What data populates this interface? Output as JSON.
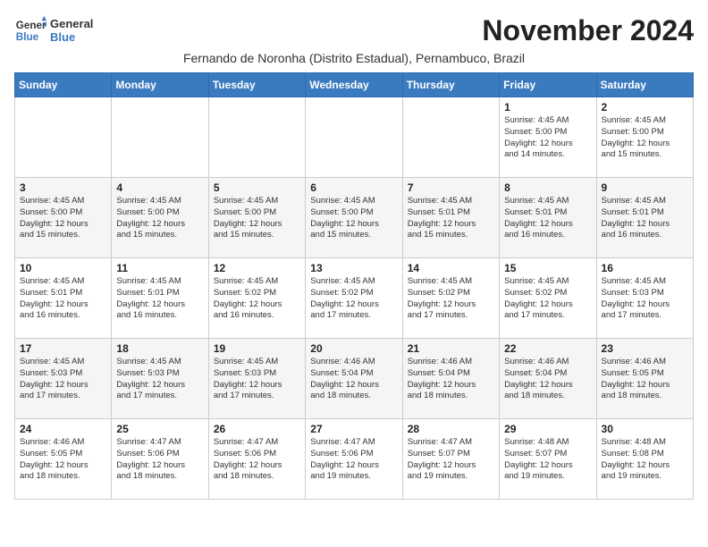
{
  "logo": {
    "line1": "General",
    "line2": "Blue"
  },
  "title": "November 2024",
  "subtitle": "Fernando de Noronha (Distrito Estadual), Pernambuco, Brazil",
  "weekdays": [
    "Sunday",
    "Monday",
    "Tuesday",
    "Wednesday",
    "Thursday",
    "Friday",
    "Saturday"
  ],
  "weeks": [
    [
      {
        "day": "",
        "info": ""
      },
      {
        "day": "",
        "info": ""
      },
      {
        "day": "",
        "info": ""
      },
      {
        "day": "",
        "info": ""
      },
      {
        "day": "",
        "info": ""
      },
      {
        "day": "1",
        "info": "Sunrise: 4:45 AM\nSunset: 5:00 PM\nDaylight: 12 hours\nand 14 minutes."
      },
      {
        "day": "2",
        "info": "Sunrise: 4:45 AM\nSunset: 5:00 PM\nDaylight: 12 hours\nand 15 minutes."
      }
    ],
    [
      {
        "day": "3",
        "info": "Sunrise: 4:45 AM\nSunset: 5:00 PM\nDaylight: 12 hours\nand 15 minutes."
      },
      {
        "day": "4",
        "info": "Sunrise: 4:45 AM\nSunset: 5:00 PM\nDaylight: 12 hours\nand 15 minutes."
      },
      {
        "day": "5",
        "info": "Sunrise: 4:45 AM\nSunset: 5:00 PM\nDaylight: 12 hours\nand 15 minutes."
      },
      {
        "day": "6",
        "info": "Sunrise: 4:45 AM\nSunset: 5:00 PM\nDaylight: 12 hours\nand 15 minutes."
      },
      {
        "day": "7",
        "info": "Sunrise: 4:45 AM\nSunset: 5:01 PM\nDaylight: 12 hours\nand 15 minutes."
      },
      {
        "day": "8",
        "info": "Sunrise: 4:45 AM\nSunset: 5:01 PM\nDaylight: 12 hours\nand 16 minutes."
      },
      {
        "day": "9",
        "info": "Sunrise: 4:45 AM\nSunset: 5:01 PM\nDaylight: 12 hours\nand 16 minutes."
      }
    ],
    [
      {
        "day": "10",
        "info": "Sunrise: 4:45 AM\nSunset: 5:01 PM\nDaylight: 12 hours\nand 16 minutes."
      },
      {
        "day": "11",
        "info": "Sunrise: 4:45 AM\nSunset: 5:01 PM\nDaylight: 12 hours\nand 16 minutes."
      },
      {
        "day": "12",
        "info": "Sunrise: 4:45 AM\nSunset: 5:02 PM\nDaylight: 12 hours\nand 16 minutes."
      },
      {
        "day": "13",
        "info": "Sunrise: 4:45 AM\nSunset: 5:02 PM\nDaylight: 12 hours\nand 17 minutes."
      },
      {
        "day": "14",
        "info": "Sunrise: 4:45 AM\nSunset: 5:02 PM\nDaylight: 12 hours\nand 17 minutes."
      },
      {
        "day": "15",
        "info": "Sunrise: 4:45 AM\nSunset: 5:02 PM\nDaylight: 12 hours\nand 17 minutes."
      },
      {
        "day": "16",
        "info": "Sunrise: 4:45 AM\nSunset: 5:03 PM\nDaylight: 12 hours\nand 17 minutes."
      }
    ],
    [
      {
        "day": "17",
        "info": "Sunrise: 4:45 AM\nSunset: 5:03 PM\nDaylight: 12 hours\nand 17 minutes."
      },
      {
        "day": "18",
        "info": "Sunrise: 4:45 AM\nSunset: 5:03 PM\nDaylight: 12 hours\nand 17 minutes."
      },
      {
        "day": "19",
        "info": "Sunrise: 4:45 AM\nSunset: 5:03 PM\nDaylight: 12 hours\nand 17 minutes."
      },
      {
        "day": "20",
        "info": "Sunrise: 4:46 AM\nSunset: 5:04 PM\nDaylight: 12 hours\nand 18 minutes."
      },
      {
        "day": "21",
        "info": "Sunrise: 4:46 AM\nSunset: 5:04 PM\nDaylight: 12 hours\nand 18 minutes."
      },
      {
        "day": "22",
        "info": "Sunrise: 4:46 AM\nSunset: 5:04 PM\nDaylight: 12 hours\nand 18 minutes."
      },
      {
        "day": "23",
        "info": "Sunrise: 4:46 AM\nSunset: 5:05 PM\nDaylight: 12 hours\nand 18 minutes."
      }
    ],
    [
      {
        "day": "24",
        "info": "Sunrise: 4:46 AM\nSunset: 5:05 PM\nDaylight: 12 hours\nand 18 minutes."
      },
      {
        "day": "25",
        "info": "Sunrise: 4:47 AM\nSunset: 5:06 PM\nDaylight: 12 hours\nand 18 minutes."
      },
      {
        "day": "26",
        "info": "Sunrise: 4:47 AM\nSunset: 5:06 PM\nDaylight: 12 hours\nand 18 minutes."
      },
      {
        "day": "27",
        "info": "Sunrise: 4:47 AM\nSunset: 5:06 PM\nDaylight: 12 hours\nand 19 minutes."
      },
      {
        "day": "28",
        "info": "Sunrise: 4:47 AM\nSunset: 5:07 PM\nDaylight: 12 hours\nand 19 minutes."
      },
      {
        "day": "29",
        "info": "Sunrise: 4:48 AM\nSunset: 5:07 PM\nDaylight: 12 hours\nand 19 minutes."
      },
      {
        "day": "30",
        "info": "Sunrise: 4:48 AM\nSunset: 5:08 PM\nDaylight: 12 hours\nand 19 minutes."
      }
    ]
  ]
}
